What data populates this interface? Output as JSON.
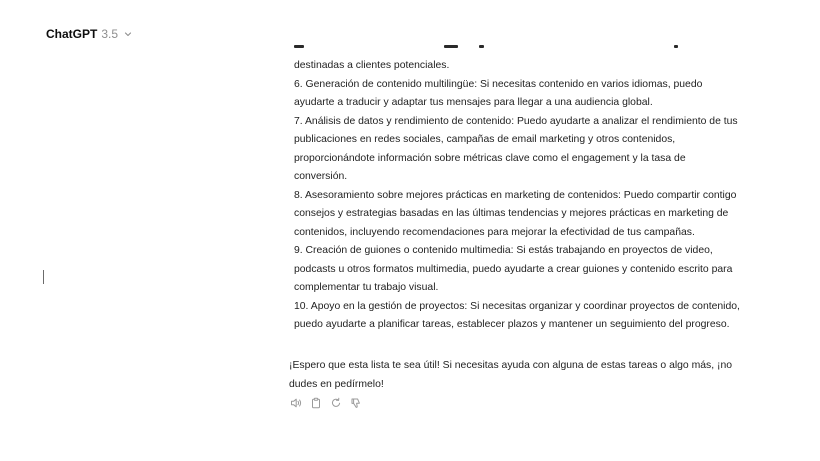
{
  "header": {
    "model_name": "ChatGPT",
    "model_version": "3.5",
    "chevron_icon": "chevron-down-icon"
  },
  "message": {
    "lines": [
      "destinadas a clientes potenciales.",
      "6. Generación de contenido multilingüe: Si necesitas contenido en varios idiomas, puedo",
      "ayudarte a traducir y adaptar tus mensajes para llegar a una audiencia global.",
      "7. Análisis de datos y rendimiento de contenido: Puedo ayudarte a analizar el rendimiento de tus",
      "publicaciones en redes sociales, campañas de email marketing y otros contenidos,",
      "proporcionándote información sobre métricas clave como el engagement y la tasa de",
      "conversión.",
      "8. Asesoramiento sobre mejores prácticas en marketing de contenidos: Puedo compartir contigo",
      "consejos y estrategias basadas en las últimas tendencias y mejores prácticas en marketing de",
      "contenidos, incluyendo recomendaciones para mejorar la efectividad de tus campañas.",
      "9. Creación de guiones o contenido multimedia: Si estás trabajando en proyectos de video,",
      "podcasts u otros formatos multimedia, puedo ayudarte a crear guiones y contenido escrito para",
      "complementar tu trabajo visual.",
      "10. Apoyo en la gestión de proyectos: Si necesitas organizar y coordinar proyectos de contenido,",
      "puedo ayudarte a planificar tareas, establecer plazos y mantener un seguimiento del progreso."
    ],
    "closing_lines": [
      "¡Espero que esta lista te sea útil! Si necesitas ayuda con alguna de estas tareas o algo más, ¡no",
      "dudes en pedírmelo!"
    ]
  },
  "actions": [
    {
      "icon": "speaker-icon",
      "name": "read-aloud-button"
    },
    {
      "icon": "clipboard-icon",
      "name": "copy-button"
    },
    {
      "icon": "regenerate-icon",
      "name": "regenerate-button"
    },
    {
      "icon": "thumbs-down-icon",
      "name": "thumbs-down-button"
    }
  ]
}
